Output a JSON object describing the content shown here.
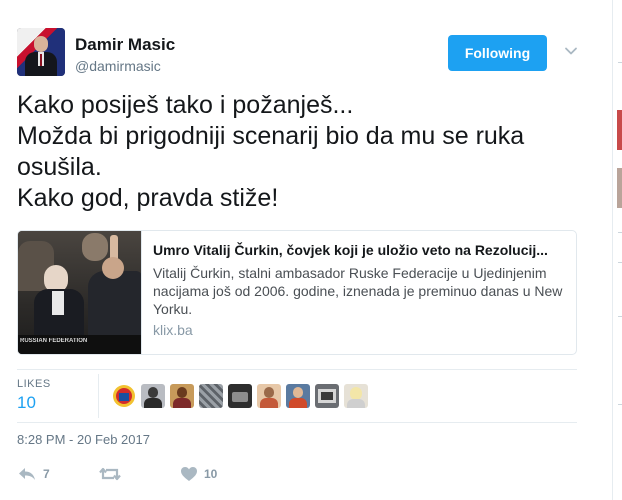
{
  "header": {
    "name": "Damir Masic",
    "handle": "@damirmasic",
    "follow_label": "Following",
    "avatar_icon": "user-avatar"
  },
  "tweet": {
    "lines": [
      "Kako posiješ tako i požanješ...",
      "Možda bi prigodniji scenarij bio da mu se ruka",
      "osušila.",
      "Kako god, pravda stiže!"
    ]
  },
  "card": {
    "title": "Umro Vitalij Čurkin, čovjek koji je uložio veto na Rezolucij...",
    "description": "Vitalij Čurkin, stalni ambasador Ruske Federacije u Ujedinjenim nacijama još od 2006. godine, iznenada je preminuo danas u New Yorku.",
    "domain": "klix.ba",
    "image_caption": "RUSSIAN FEDERATION"
  },
  "likes": {
    "label": "LIKES",
    "count": "10"
  },
  "timestamp": "8:28 PM - 20 Feb 2017",
  "actions": {
    "reply_count": "7",
    "retweet_count": "",
    "like_count": "10"
  },
  "colors": {
    "accent": "#1da1f2",
    "text": "#14171a",
    "muted": "#657786",
    "icon_muted": "#aab8c2"
  }
}
